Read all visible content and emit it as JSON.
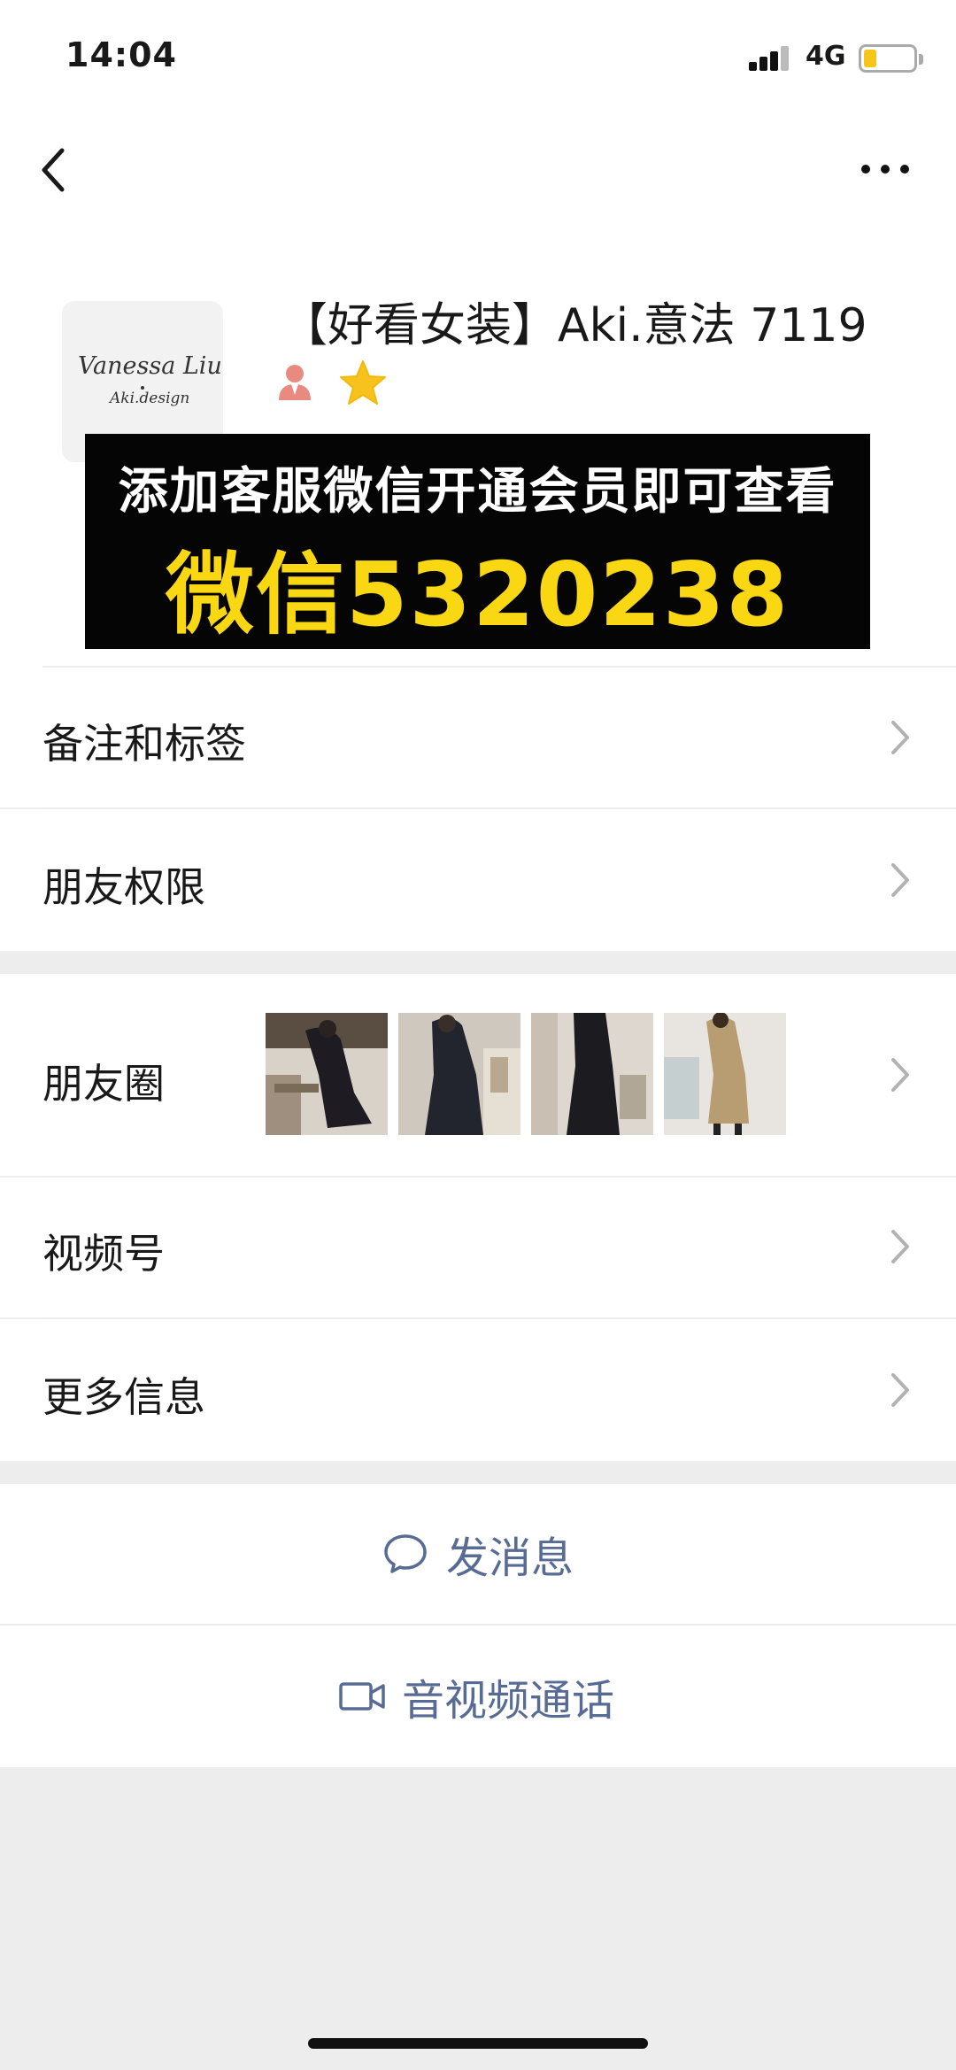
{
  "status_bar": {
    "time": "14:04",
    "network": "4G"
  },
  "profile": {
    "name": "【好看女装】Aki.意法 7119",
    "avatar_line1": "Vanessa Liu",
    "avatar_line2": "Aki.design"
  },
  "promo_banner": {
    "line1": "添加客服微信开通会员即可查看",
    "line2": "微信5320238"
  },
  "menu": {
    "remarks": "备注和标签",
    "permissions": "朋友权限",
    "moments": "朋友圈",
    "channels": "视频号",
    "more_info": "更多信息"
  },
  "actions": {
    "send_message": "发消息",
    "av_call": "音视频通话"
  },
  "colors": {
    "link_blue": "#576b95",
    "banner_yellow": "#f9d712",
    "star": "#f7c21e",
    "person_badge": "#e88a80"
  }
}
